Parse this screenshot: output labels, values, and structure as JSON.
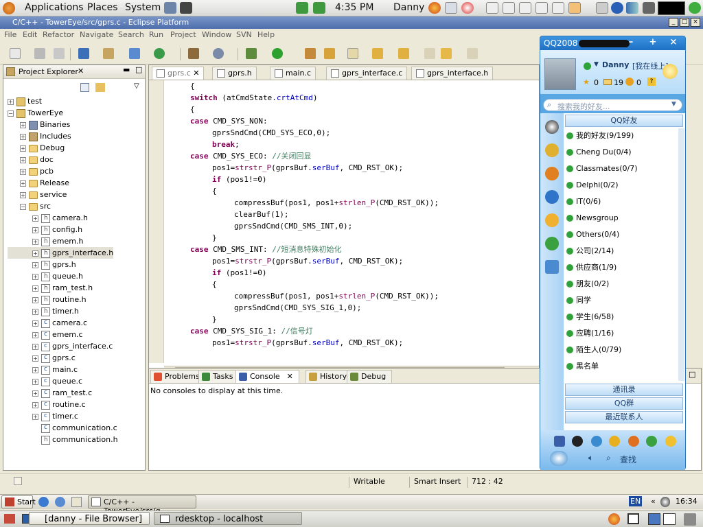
{
  "top_panel": {
    "menus": [
      "Applications",
      "Places",
      "System"
    ],
    "time": "4:35 PM",
    "user": "Danny"
  },
  "eclipse": {
    "title": "C/C++ - TowerEye/src/gprs.c - Eclipse Platform",
    "menu": [
      "File",
      "Edit",
      "Refactor",
      "Navigate",
      "Search",
      "Run",
      "Project",
      "Window",
      "SVN",
      "Help"
    ],
    "explorer": {
      "title": "Project Explorer",
      "tree": [
        {
          "label": "test",
          "type": "proj",
          "depth": 0,
          "toggle": "+"
        },
        {
          "label": "TowerEye",
          "type": "proj",
          "depth": 0,
          "toggle": "-"
        },
        {
          "label": "Binaries",
          "type": "bin",
          "depth": 1,
          "toggle": "+"
        },
        {
          "label": "Includes",
          "type": "inc",
          "depth": 1,
          "toggle": "+"
        },
        {
          "label": "Debug",
          "type": "folder",
          "depth": 1,
          "toggle": "+"
        },
        {
          "label": "doc",
          "type": "folder",
          "depth": 1,
          "toggle": "+"
        },
        {
          "label": "pcb",
          "type": "folder",
          "depth": 1,
          "toggle": "+"
        },
        {
          "label": "Release",
          "type": "folder",
          "depth": 1,
          "toggle": "+"
        },
        {
          "label": "service",
          "type": "folder",
          "depth": 1,
          "toggle": "+"
        },
        {
          "label": "src",
          "type": "folder",
          "depth": 1,
          "toggle": "-"
        },
        {
          "label": "camera.h",
          "type": "h",
          "depth": 2,
          "toggle": "+"
        },
        {
          "label": "config.h",
          "type": "h",
          "depth": 2,
          "toggle": "+"
        },
        {
          "label": "emem.h",
          "type": "h",
          "depth": 2,
          "toggle": "+"
        },
        {
          "label": "gprs_interface.h",
          "type": "h",
          "depth": 2,
          "toggle": "+",
          "selected": true
        },
        {
          "label": "gprs.h",
          "type": "h",
          "depth": 2,
          "toggle": "+"
        },
        {
          "label": "queue.h",
          "type": "h",
          "depth": 2,
          "toggle": "+"
        },
        {
          "label": "ram_test.h",
          "type": "h",
          "depth": 2,
          "toggle": "+"
        },
        {
          "label": "routine.h",
          "type": "h",
          "depth": 2,
          "toggle": "+"
        },
        {
          "label": "timer.h",
          "type": "h",
          "depth": 2,
          "toggle": "+"
        },
        {
          "label": "camera.c",
          "type": "c",
          "depth": 2,
          "toggle": "+"
        },
        {
          "label": "emem.c",
          "type": "c",
          "depth": 2,
          "toggle": "+"
        },
        {
          "label": "gprs_interface.c",
          "type": "c",
          "depth": 2,
          "toggle": "+"
        },
        {
          "label": "gprs.c",
          "type": "c",
          "depth": 2,
          "toggle": "+"
        },
        {
          "label": "main.c",
          "type": "c",
          "depth": 2,
          "toggle": "+"
        },
        {
          "label": "queue.c",
          "type": "c",
          "depth": 2,
          "toggle": "+"
        },
        {
          "label": "ram_test.c",
          "type": "c",
          "depth": 2,
          "toggle": "+"
        },
        {
          "label": "routine.c",
          "type": "c",
          "depth": 2,
          "toggle": "+"
        },
        {
          "label": "timer.c",
          "type": "c",
          "depth": 2,
          "toggle": "+"
        },
        {
          "label": "communication.c",
          "type": "c",
          "depth": 2,
          "toggle": ""
        },
        {
          "label": "communication.h",
          "type": "h",
          "depth": 2,
          "toggle": ""
        }
      ]
    },
    "editor_tabs": [
      "gprs.c",
      "gprs.h",
      "main.c",
      "gprs_interface.c",
      "gprs_interface.h"
    ],
    "code": [
      [
        [
          "t",
          "{"
        ]
      ],
      [
        [
          "k",
          "switch"
        ],
        [
          "t",
          " (atCmdState."
        ],
        [
          "f",
          "crtAtCmd"
        ],
        [
          "t",
          ")"
        ]
      ],
      [
        [
          "t",
          "{"
        ]
      ],
      [
        [
          "k",
          "case"
        ],
        [
          "t",
          " CMD_SYS_NON:"
        ]
      ],
      [
        [
          "t",
          "gprsSndCmd(CMD_SYS_ECO,0);"
        ]
      ],
      [
        [
          "k",
          "break"
        ],
        [
          "t",
          ";"
        ]
      ],
      [
        [
          "k",
          "case"
        ],
        [
          "t",
          " CMD_SYS_ECO: "
        ],
        [
          "c",
          "//关闭回显"
        ]
      ],
      [
        [
          "t",
          "pos1="
        ],
        [
          "n",
          "strstr_P"
        ],
        [
          "t",
          "(gprsBuf."
        ],
        [
          "f",
          "serBuf"
        ],
        [
          "t",
          ", CMD_RST_OK);"
        ]
      ],
      [
        [
          "k",
          "if"
        ],
        [
          "t",
          " (pos1!=0)"
        ]
      ],
      [
        [
          "t",
          "{"
        ]
      ],
      [
        [
          "t",
          "compressBuf(pos1, pos1+"
        ],
        [
          "n",
          "strlen_P"
        ],
        [
          "t",
          "(CMD_RST_OK));"
        ]
      ],
      [
        [
          "t",
          "clearBuf(1);"
        ]
      ],
      [
        [
          "t",
          "gprsSndCmd(CMD_SMS_INT,0);"
        ]
      ],
      [
        [
          "t",
          "}"
        ]
      ],
      [
        [
          "k",
          "case"
        ],
        [
          "t",
          " CMD_SMS_INT: "
        ],
        [
          "c",
          "//短消息特殊初始化"
        ]
      ],
      [
        [
          "t",
          "pos1="
        ],
        [
          "n",
          "strstr_P"
        ],
        [
          "t",
          "(gprsBuf."
        ],
        [
          "f",
          "serBuf"
        ],
        [
          "t",
          ", CMD_RST_OK);"
        ]
      ],
      [
        [
          "k",
          "if"
        ],
        [
          "t",
          " (pos1!=0)"
        ]
      ],
      [
        [
          "t",
          "{"
        ]
      ],
      [
        [
          "t",
          "compressBuf(pos1, pos1+"
        ],
        [
          "n",
          "strlen_P"
        ],
        [
          "t",
          "(CMD_RST_OK));"
        ]
      ],
      [
        [
          "t",
          "gprsSndCmd(CMD_SYS_SIG_1,0);"
        ]
      ],
      [
        [
          "t",
          "}"
        ]
      ],
      [
        [
          "k",
          "case"
        ],
        [
          "t",
          " CMD_SYS_SIG_1: "
        ],
        [
          "c",
          "//信号灯"
        ]
      ],
      [
        [
          "t",
          "pos1="
        ],
        [
          "n",
          "strstr_P"
        ],
        [
          "t",
          "(gprsBuf."
        ],
        [
          "f",
          "serBuf"
        ],
        [
          "t",
          ", CMD_RST_OK);"
        ]
      ]
    ],
    "code_indent": [
      2,
      2,
      2,
      2,
      3,
      3,
      2,
      3,
      3,
      3,
      4,
      4,
      4,
      3,
      2,
      3,
      3,
      3,
      4,
      4,
      3,
      2,
      3
    ],
    "console_tabs": [
      "Problems",
      "Tasks",
      "Console",
      "History",
      "Debug"
    ],
    "console_message": "No consoles to display at this time.",
    "status": {
      "writable": "Writable",
      "insert": "Smart Insert",
      "position": "712 : 42"
    }
  },
  "qq": {
    "title": "QQ2008",
    "nickname": "Danny",
    "status": "[我在线上]",
    "counts": [
      "0",
      "19",
      "0"
    ],
    "search_placeholder": "搜索我的好友...",
    "header": "QQ好友",
    "groups": [
      "我的好友(9/199)",
      "Cheng Du(0/4)",
      "Classmates(0/7)",
      "Delphi(0/2)",
      "IT(0/6)",
      "Newsgroup",
      "Others(0/4)",
      "公司(2/14)",
      "供应商(1/9)",
      "朋友(0/2)",
      "同学",
      "学生(6/58)",
      "应聘(1/16)",
      "陌生人(0/79)",
      "黑名单"
    ],
    "footer_tabs": [
      "通讯录",
      "QQ群",
      "最近联系人"
    ],
    "find": "查找"
  },
  "taskbar": {
    "start": "Start",
    "task": "C/C++ - TowerEye/src/g...",
    "lang": "EN",
    "time": "16:34",
    "bottom_tasks": [
      "[danny - File Browser]",
      "rdesktop - localhost"
    ]
  }
}
